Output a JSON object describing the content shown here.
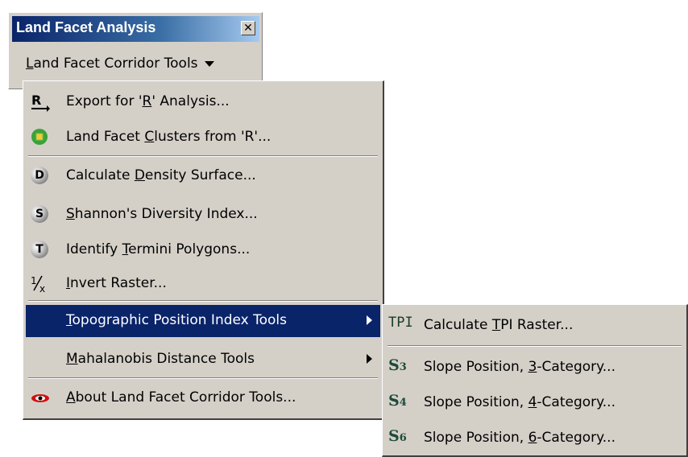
{
  "toolbar": {
    "title": "Land Facet Analysis",
    "close_glyph": "✕",
    "menu_label_pre": "",
    "menu_label_u": "L",
    "menu_label_post": "and Facet Corridor Tools"
  },
  "main_menu": {
    "items": [
      {
        "icon": "export-r-icon",
        "pre": "Export for '",
        "u": "R",
        "post": "' Analysis..."
      },
      {
        "icon": "clusters-icon",
        "pre": "Land Facet ",
        "u": "C",
        "post": "lusters from 'R'..."
      },
      {
        "icon": "density-icon",
        "icon_text": "D",
        "pre": "Calculate ",
        "u": "D",
        "post": "ensity Surface..."
      },
      {
        "icon": "shannon-icon",
        "icon_text": "S",
        "pre": "",
        "u": "S",
        "post": "hannon's Diversity Index..."
      },
      {
        "icon": "termini-icon",
        "icon_text": "T",
        "pre": "Identify ",
        "u": "T",
        "post": "ermini Polygons..."
      },
      {
        "icon": "invert-icon",
        "pre": "",
        "u": "I",
        "post": "nvert Raster..."
      },
      {
        "icon": "",
        "pre": "",
        "u": "T",
        "post": "opographic Position Index Tools"
      },
      {
        "icon": "",
        "pre": "",
        "u": "M",
        "post": "ahalanobis Distance Tools"
      },
      {
        "icon": "about-eye-icon",
        "pre": "",
        "u": "A",
        "post": "bout Land Facet Corridor Tools..."
      }
    ]
  },
  "sub_menu": {
    "items": [
      {
        "icon": "tpi-icon",
        "icon_text": "TPI",
        "pre": "Calculate ",
        "u": "T",
        "post": "PI Raster..."
      },
      {
        "icon": "slope-3-icon",
        "icon_text": "S",
        "icon_sub": "3",
        "pre": "Slope Position, ",
        "u": "3",
        "post": "-Category..."
      },
      {
        "icon": "slope-4-icon",
        "icon_text": "S",
        "icon_sub": "4",
        "pre": "Slope Position, ",
        "u": "4",
        "post": "-Category..."
      },
      {
        "icon": "slope-6-icon",
        "icon_text": "S",
        "icon_sub": "6",
        "pre": "Slope Position, ",
        "u": "6",
        "post": "-Category..."
      }
    ]
  },
  "colors": {
    "menu_bg": "#d4d0c8",
    "highlight": "#0a246a",
    "title_start": "#0a246a",
    "title_end": "#a6caf0"
  }
}
